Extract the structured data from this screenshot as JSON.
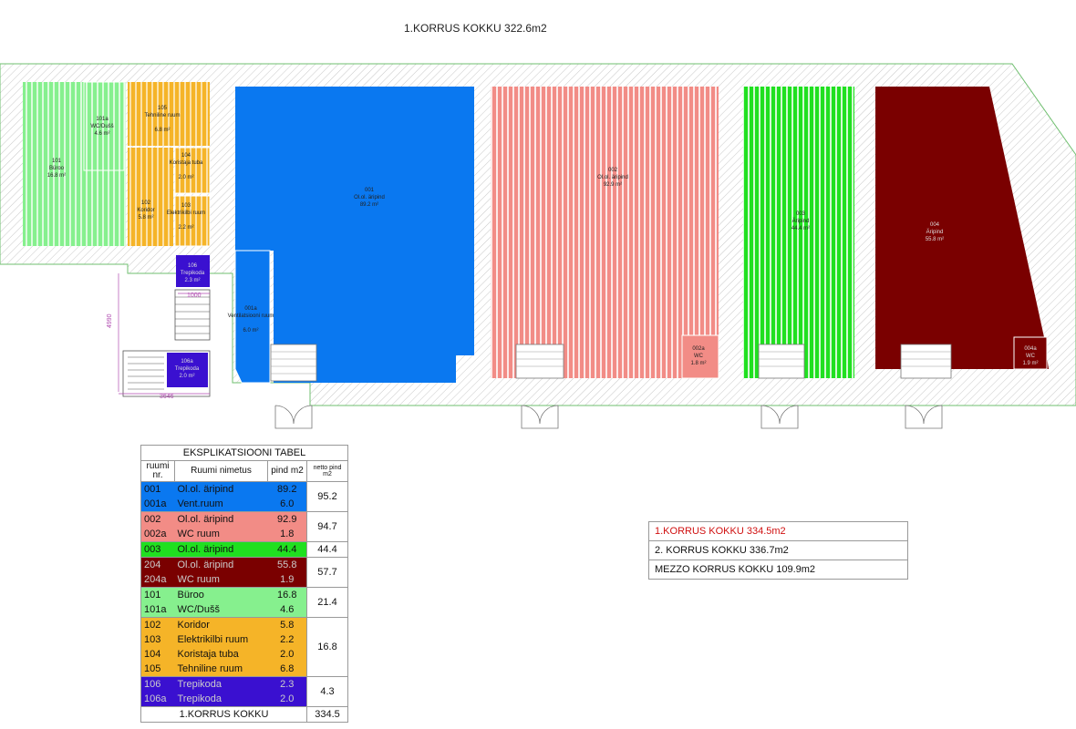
{
  "header": {
    "title": "1.KORRUS KOKKU 322.6m2"
  },
  "colors": {
    "blue": "#0a78f0",
    "salmon": "#f28c86",
    "green": "#20e020",
    "darkred": "#7a0000",
    "lightgreen": "#86f08e",
    "orange": "#f5b428",
    "purple": "#3a10d0"
  },
  "plan": {
    "rooms": [
      {
        "nr": "101",
        "name": "Büroo",
        "area": "16.8 m²"
      },
      {
        "nr": "101a",
        "name": "WC/Dušš",
        "area": "4.6 m²"
      },
      {
        "nr": "105",
        "name": "Tehniline ruum",
        "area": "6.8 m²"
      },
      {
        "nr": "104",
        "name": "Koristaja tuba",
        "area": "2.0 m²"
      },
      {
        "nr": "102",
        "name": "Koridor",
        "area": "5.8 m²"
      },
      {
        "nr": "103",
        "name": "Elektrikilbi ruum",
        "area": "2.2 m²"
      },
      {
        "nr": "001",
        "name": "Ol.ol. äripind",
        "area": "89.2 m²"
      },
      {
        "nr": "001a",
        "name": "Ventilatsiooni ruum",
        "area": "6.0 m²"
      },
      {
        "nr": "002",
        "name": "Ol.ol. äripind",
        "area": "92.9 m²"
      },
      {
        "nr": "002a",
        "name": "WC",
        "area": "1.8 m²"
      },
      {
        "nr": "003",
        "name": "Äripind",
        "area": "44.4 m²"
      },
      {
        "nr": "004",
        "name": "Äripind",
        "area": "55.8 m²"
      },
      {
        "nr": "004a",
        "name": "WC",
        "area": "1.9 m²"
      },
      {
        "nr": "106",
        "name": "Trepikoda",
        "area": "2.3 m²"
      },
      {
        "nr": "106a",
        "name": "Trepikoda",
        "area": "2.0 m²"
      }
    ],
    "dims": {
      "d1": "1000",
      "d2": "4990",
      "d3": "3646"
    }
  },
  "table": {
    "title": "EKSPLIKATSIOONI TABEL",
    "headers": {
      "nr": "ruumi nr.",
      "name": "Ruumi nimetus",
      "pind": "pind m2",
      "netto": "netto pind m2"
    },
    "groups": [
      {
        "color": "#0a78f0",
        "net": "95.2",
        "rows": [
          {
            "nr": "001",
            "name": "Ol.ol. äripind",
            "pind": "89.2"
          },
          {
            "nr": "001a",
            "name": "Vent.ruum",
            "pind": "6.0"
          }
        ]
      },
      {
        "color": "#f28c86",
        "net": "94.7",
        "rows": [
          {
            "nr": "002",
            "name": "Ol.ol. äripind",
            "pind": "92.9"
          },
          {
            "nr": "002a",
            "name": "WC ruum",
            "pind": "1.8"
          }
        ]
      },
      {
        "color": "#20e020",
        "net": "44.4",
        "rows": [
          {
            "nr": "003",
            "name": "Ol.ol. äripind",
            "pind": "44.4"
          }
        ]
      },
      {
        "color": "#7a0000",
        "net": "57.7",
        "rows": [
          {
            "nr": "204",
            "name": "Ol.ol. äripind",
            "pind": "55.8"
          },
          {
            "nr": "204a",
            "name": "WC ruum",
            "pind": "1.9"
          }
        ]
      },
      {
        "color": "#86f08e",
        "net": "21.4",
        "rows": [
          {
            "nr": "101",
            "name": "Büroo",
            "pind": "16.8"
          },
          {
            "nr": "101a",
            "name": "WC/Dušš",
            "pind": "4.6"
          }
        ]
      },
      {
        "color": "#f5b428",
        "net": "16.8",
        "rows": [
          {
            "nr": "102",
            "name": "Koridor",
            "pind": "5.8"
          },
          {
            "nr": "103",
            "name": "Elektrikilbi ruum",
            "pind": "2.2"
          },
          {
            "nr": "104",
            "name": "Koristaja tuba",
            "pind": "2.0"
          },
          {
            "nr": "105",
            "name": "Tehniline ruum",
            "pind": "6.8"
          }
        ]
      },
      {
        "color": "#3a10d0",
        "net": "4.3",
        "rows": [
          {
            "nr": "106",
            "name": "Trepikoda",
            "pind": "2.3"
          },
          {
            "nr": "106a",
            "name": "Trepikoda",
            "pind": "2.0"
          }
        ]
      }
    ],
    "total": {
      "label": "1.KORRUS KOKKU",
      "value": "334.5"
    }
  },
  "summary": {
    "line1": "1.KORRUS KOKKU 334.5m2",
    "line1_color": "#d01010",
    "line2": "2. KORRUS KOKKU 336.7m2",
    "line3": "MEZZO KORRUS KOKKU 109.9m2"
  }
}
